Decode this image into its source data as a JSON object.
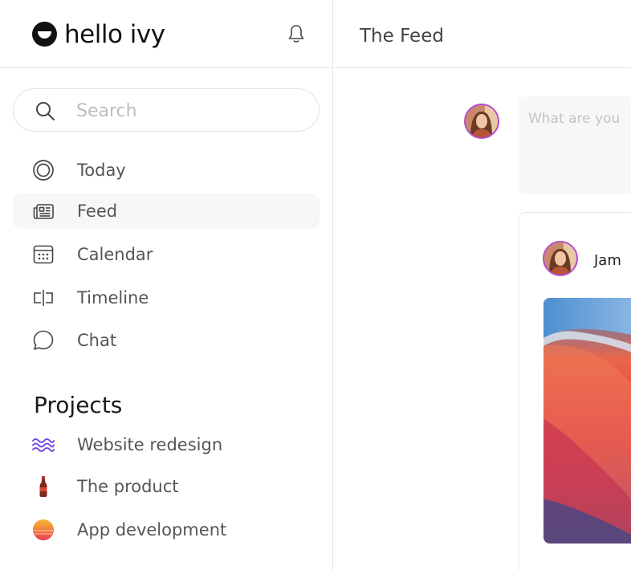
{
  "app": {
    "name": "hello ivy"
  },
  "sidebar": {
    "search": {
      "placeholder": "Search",
      "value": ""
    },
    "nav": [
      {
        "label": "Today",
        "icon": "today-ring-icon",
        "active": false
      },
      {
        "label": "Feed",
        "icon": "feed-icon",
        "active": true
      },
      {
        "label": "Calendar",
        "icon": "calendar-icon",
        "active": false
      },
      {
        "label": "Timeline",
        "icon": "timeline-icon",
        "active": false
      },
      {
        "label": "Chat",
        "icon": "chat-bubble-icon",
        "active": false
      }
    ],
    "projects_heading": "Projects",
    "projects": [
      {
        "label": "Website redesign",
        "icon": "wave-icon",
        "color": "#6b3fe0"
      },
      {
        "label": "The product",
        "icon": "cola-bottle-icon",
        "color": "#b8352a"
      },
      {
        "label": "App development",
        "icon": "sunset-circle-icon",
        "color": "#f2a33a"
      }
    ]
  },
  "main": {
    "title": "The Feed",
    "composer": {
      "placeholder": "What are you"
    },
    "post": {
      "author": "Jam"
    }
  },
  "colors": {
    "avatar_ring": "#b54bd6",
    "active_nav_bg": "#f7f7f7",
    "divider": "#e6e6e6"
  }
}
